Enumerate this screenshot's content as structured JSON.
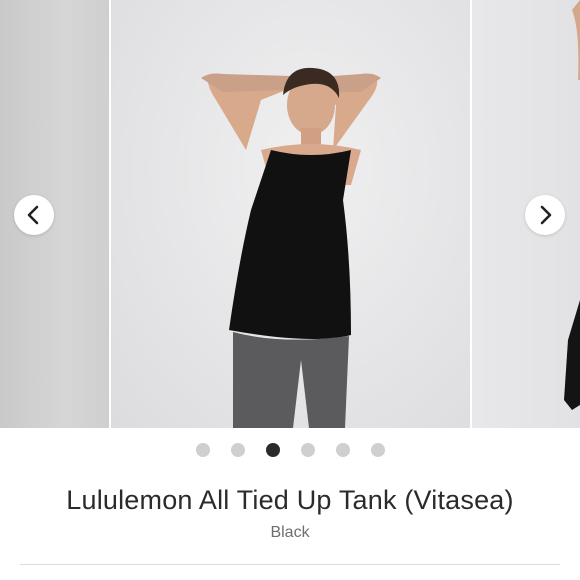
{
  "product": {
    "title": "Lululemon All Tied Up Tank (Vitasea)",
    "color": "Black"
  },
  "carousel": {
    "prev_icon": "chevron-left-icon",
    "next_icon": "chevron-right-icon",
    "dot_count": 6,
    "active_index": 2,
    "colors": {
      "dot_inactive": "#cfcfcf",
      "dot_active": "#2b2b2b",
      "tank": "#111111",
      "leggings": "#5b5b5e"
    }
  }
}
